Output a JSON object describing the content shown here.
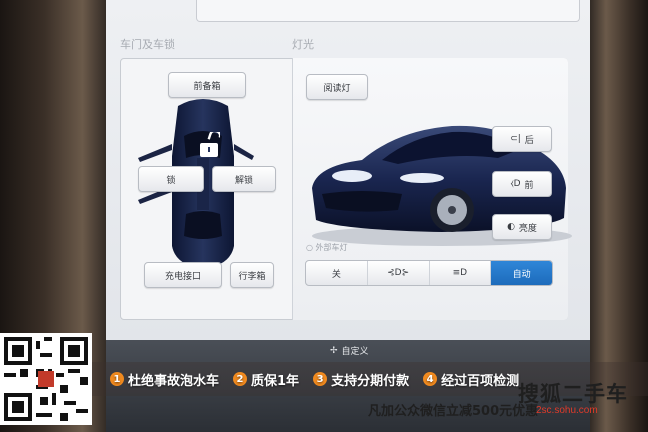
{
  "sections": {
    "doors_title": "车门及车锁",
    "lights_title": "灯光"
  },
  "doors": {
    "frunk_label": "前备箱",
    "lock_label": "锁",
    "unlock_label": "解锁",
    "charge_port_label": "充电接口",
    "trunk_label": "行李箱"
  },
  "lights": {
    "reading_light_label": "阅读灯",
    "rear_fog_label": "后",
    "front_fog_label": "前",
    "brightness_label": "亮度",
    "exterior_lights_label": "外部车灯",
    "modes": [
      "关",
      "",
      "",
      "自动"
    ],
    "active_mode_index": 3
  },
  "dock": {
    "custom_label": "自定义"
  },
  "watermark": {
    "features": [
      {
        "num": "1",
        "text": "杜绝事故泡水车"
      },
      {
        "num": "2",
        "text": "质保1年"
      },
      {
        "num": "3",
        "text": "支持分期付款"
      },
      {
        "num": "4",
        "text": "经过百项检测"
      }
    ],
    "footline": "凡加公众微信立减500元优惠",
    "brand": "搜狐二手车",
    "brand_url": "2sc.sohu.com"
  },
  "colors": {
    "accent": "#1d6bbb",
    "badge": "#f08a1f"
  }
}
